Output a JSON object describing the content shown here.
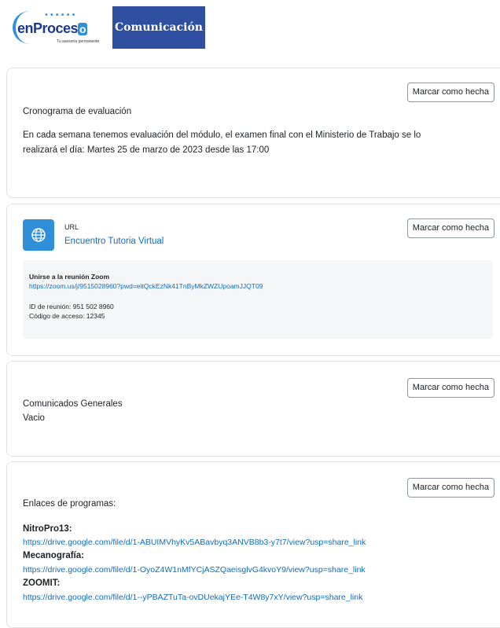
{
  "banner": {
    "logo_text_main": "enProces",
    "logo_text_o": "o",
    "logo_tagline": "Tu asesoría permanente",
    "section_title": "Comunicación"
  },
  "cards": {
    "cronograma": {
      "button": "Marcar como hecha",
      "title": "Cronograma de evaluación",
      "body_line1": "En cada semana tenemos evaluación del módulo, el examen final con el Ministerio de Trabajo se lo",
      "body_line2": "realizará el día: Martes 25 de marzo de 2023 desde las 17:00"
    },
    "url": {
      "button": "Marcar como hecha",
      "type_label": "URL",
      "link_text": "Encuentro Tutoria Virtual",
      "zoom_heading": "Unirse a la reunión Zoom",
      "zoom_link": "https://zoom.us/j/9515028960?pwd=eitQckEzNk41TnByMkZWZUpoamJJQT09",
      "meeting_id": "ID de reunión: 951 502 8960",
      "access_code": "Código de acceso: 12345"
    },
    "comunicados": {
      "button": "Marcar como hecha",
      "title": "Comunicados Generales",
      "body": "Vacio"
    },
    "enlaces": {
      "button": "Marcar como hecha",
      "title": "Enlaces de programas:",
      "items": [
        {
          "name": "NitroPro13:",
          "url": "https://drive.google.com/file/d/1-ABUIMVhyKv5ABavbyq3ANVB8b3-y7t7/view?usp=share_link"
        },
        {
          "name": "Mecanografía:",
          "url": "https://drive.google.com/file/d/1-OyoZ4W1nMfYCjASZQaeisglvG4kvoY9/view?usp=share_link"
        },
        {
          "name": "ZOOMIT:",
          "url": "https://drive.google.com/file/d/1--yPBAZTuTa-ovDUekajYEe-T4W8y7xY/view?usp=share_link"
        }
      ]
    }
  },
  "colors": {
    "accent": "#0f6cbf",
    "banner_blue": "#2f4fa1",
    "icon_blue": "#2f8fd8"
  },
  "icons": {
    "url_icon": "globe-icon"
  }
}
